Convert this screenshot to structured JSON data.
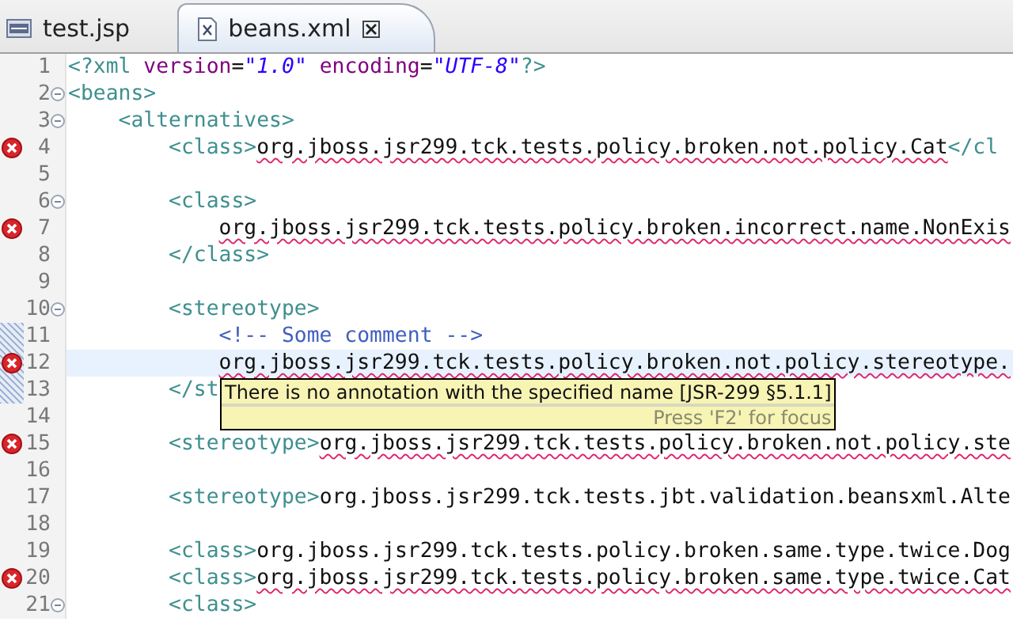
{
  "tabs": [
    {
      "label": "test.jsp",
      "kind": "jsp",
      "selected": false,
      "closable": false
    },
    {
      "label": "beans.xml",
      "kind": "xml",
      "selected": true,
      "closable": true
    }
  ],
  "editor": {
    "lines": [
      {
        "number": "1",
        "fold": false,
        "error": false,
        "current": false,
        "range": false,
        "tokens": [
          {
            "kind": "tag",
            "text": "<?xml"
          },
          {
            "kind": "attr",
            "text": " version"
          },
          {
            "kind": "plain",
            "text": "="
          },
          {
            "kind": "value",
            "text": "\"1.0\""
          },
          {
            "kind": "attr",
            "text": " encoding"
          },
          {
            "kind": "plain",
            "text": "="
          },
          {
            "kind": "value",
            "text": "\"UTF-8\""
          },
          {
            "kind": "tag",
            "text": "?>"
          }
        ]
      },
      {
        "number": "2",
        "fold": true,
        "error": false,
        "current": false,
        "range": false,
        "tokens": [
          {
            "kind": "tag",
            "text": "<beans>"
          }
        ]
      },
      {
        "number": "3",
        "fold": true,
        "error": false,
        "current": false,
        "range": false,
        "tokens": [
          {
            "kind": "tag",
            "text": "    <alternatives>"
          }
        ]
      },
      {
        "number": "4",
        "fold": false,
        "error": true,
        "current": false,
        "range": false,
        "tokens": [
          {
            "kind": "tag",
            "text": "        <class>"
          },
          {
            "kind": "error",
            "text": "org.jboss.jsr299.tck.tests.policy.broken.not.policy.Cat"
          },
          {
            "kind": "tag",
            "text": "</cl"
          }
        ]
      },
      {
        "number": "5",
        "fold": false,
        "error": false,
        "current": false,
        "range": false
      },
      {
        "number": "6",
        "fold": true,
        "error": false,
        "current": false,
        "range": false,
        "tokens": [
          {
            "kind": "tag",
            "text": "        <class>"
          }
        ]
      },
      {
        "number": "7",
        "fold": false,
        "error": true,
        "current": false,
        "range": false,
        "tokens": [
          {
            "kind": "error",
            "text": "            org.jboss.jsr299.tck.tests.policy.broken.incorrect.name.NonExis"
          }
        ]
      },
      {
        "number": "8",
        "fold": false,
        "error": false,
        "current": false,
        "range": false,
        "tokens": [
          {
            "kind": "tag",
            "text": "        </class>"
          }
        ]
      },
      {
        "number": "9",
        "fold": false,
        "error": false,
        "current": false,
        "range": false
      },
      {
        "number": "10",
        "fold": true,
        "error": false,
        "current": false,
        "range": false,
        "tokens": [
          {
            "kind": "tag",
            "text": "        <stereotype>"
          }
        ]
      },
      {
        "number": "11",
        "fold": false,
        "error": false,
        "current": false,
        "range": true,
        "tokens": [
          {
            "kind": "comment",
            "text": "            <!-- Some comment -->"
          }
        ]
      },
      {
        "number": "12",
        "fold": false,
        "error": true,
        "current": true,
        "range": true,
        "tokens": [
          {
            "kind": "error",
            "text": "            org.jboss.jsr299.tck.tests.policy.broken.not.policy.stereotype."
          }
        ]
      },
      {
        "number": "13",
        "fold": false,
        "error": false,
        "current": false,
        "range": true,
        "tokens": [
          {
            "kind": "tag",
            "text": "        </st"
          }
        ]
      },
      {
        "number": "14",
        "fold": false,
        "error": false,
        "current": false,
        "range": false
      },
      {
        "number": "15",
        "fold": false,
        "error": true,
        "current": false,
        "range": false,
        "tokens": [
          {
            "kind": "tag",
            "text": "        <stereotype>"
          },
          {
            "kind": "error",
            "text": "org.jboss.jsr299.tck.tests.policy.broken.not.policy.ste"
          }
        ]
      },
      {
        "number": "16",
        "fold": false,
        "error": false,
        "current": false,
        "range": false
      },
      {
        "number": "17",
        "fold": false,
        "error": false,
        "current": false,
        "range": false,
        "tokens": [
          {
            "kind": "tag",
            "text": "        <stereotype>"
          },
          {
            "kind": "plain",
            "text": "org.jboss.jsr299.tck.tests.jbt.validation.beansxml.Alte"
          }
        ]
      },
      {
        "number": "18",
        "fold": false,
        "error": false,
        "current": false,
        "range": false
      },
      {
        "number": "19",
        "fold": false,
        "error": false,
        "current": false,
        "range": false,
        "tokens": [
          {
            "kind": "tag",
            "text": "        <class>"
          },
          {
            "kind": "plain",
            "text": "org.jboss.jsr299.tck.tests.policy.broken.same.type.twice.Dog"
          }
        ]
      },
      {
        "number": "20",
        "fold": false,
        "error": true,
        "current": false,
        "range": false,
        "tokens": [
          {
            "kind": "tag",
            "text": "        <class>"
          },
          {
            "kind": "error",
            "text": "org.jboss.jsr299.tck.tests.policy.broken.same.type.twice.Cat"
          }
        ]
      },
      {
        "number": "21",
        "fold": true,
        "error": false,
        "current": false,
        "range": false,
        "tokens": [
          {
            "kind": "tag",
            "text": "        <class>"
          }
        ]
      }
    ]
  },
  "tooltip": {
    "message": "There is no annotation with the specified name [JSR-299 §5.1.1]",
    "hint": "Press 'F2' for focus"
  }
}
